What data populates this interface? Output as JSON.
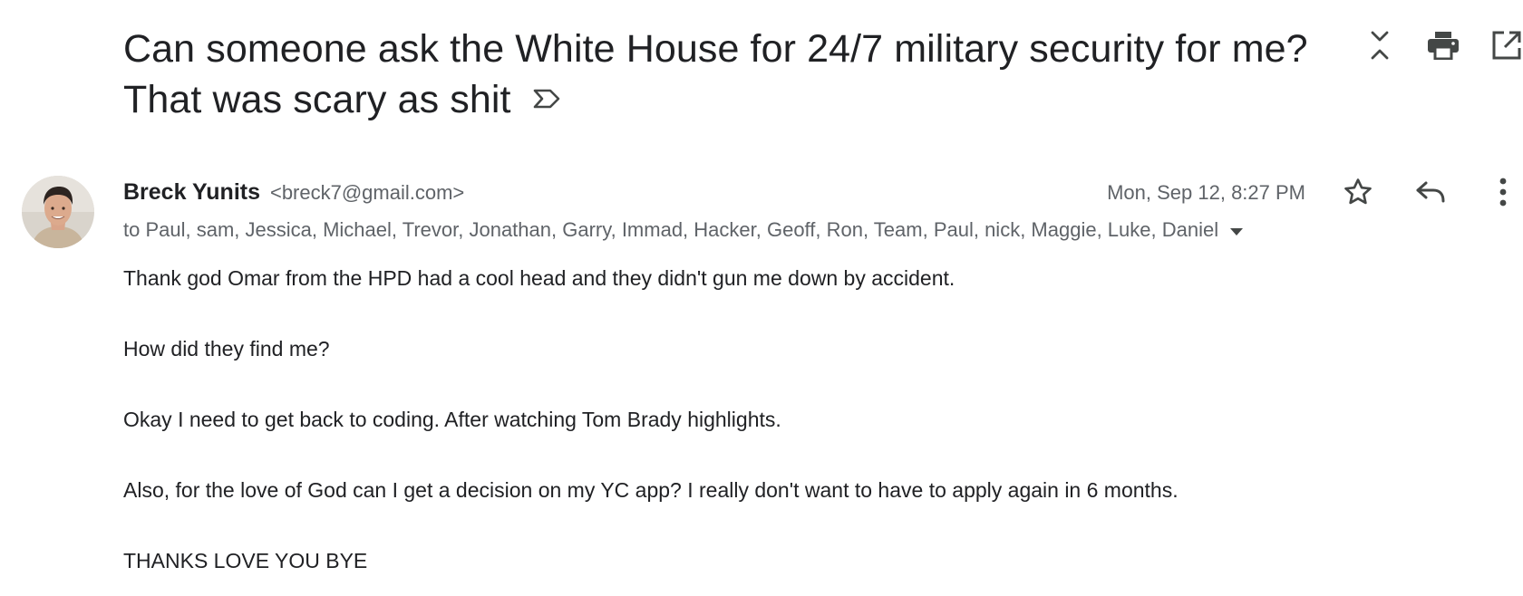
{
  "subject": "Can someone ask the White House for 24/7 military security for me? That was scary as shit",
  "icons": {
    "label": "label-arrow-icon",
    "expand": "unfold-icon",
    "print": "print-icon",
    "popout": "open-in-new-window-icon",
    "star": "star-outline-icon",
    "reply": "reply-icon",
    "more": "more-vertical-icon",
    "recipients_toggle": "caret-down-icon"
  },
  "message": {
    "sender_name": "Breck Yunits",
    "sender_email": "<breck7@gmail.com>",
    "recipients": "to Paul, sam, Jessica, Michael, Trevor, Jonathan, Garry, Immad, Hacker, Geoff, Ron, Team, Paul, nick, Maggie, Luke, Daniel",
    "date": "Mon, Sep 12, 8:27 PM",
    "body": [
      "Thank god Omar from the HPD had a cool head and they didn't gun me down by accident.",
      "How did they find me?",
      "Okay I need to get back to coding. After watching Tom Brady highlights.",
      "Also, for the love of God can I get a decision on my YC app? I really don't want to have to apply again in 6 months.",
      "THANKS LOVE YOU BYE"
    ]
  },
  "colors": {
    "text_primary": "#202124",
    "text_secondary": "#5f6368",
    "icon": "#444746"
  }
}
